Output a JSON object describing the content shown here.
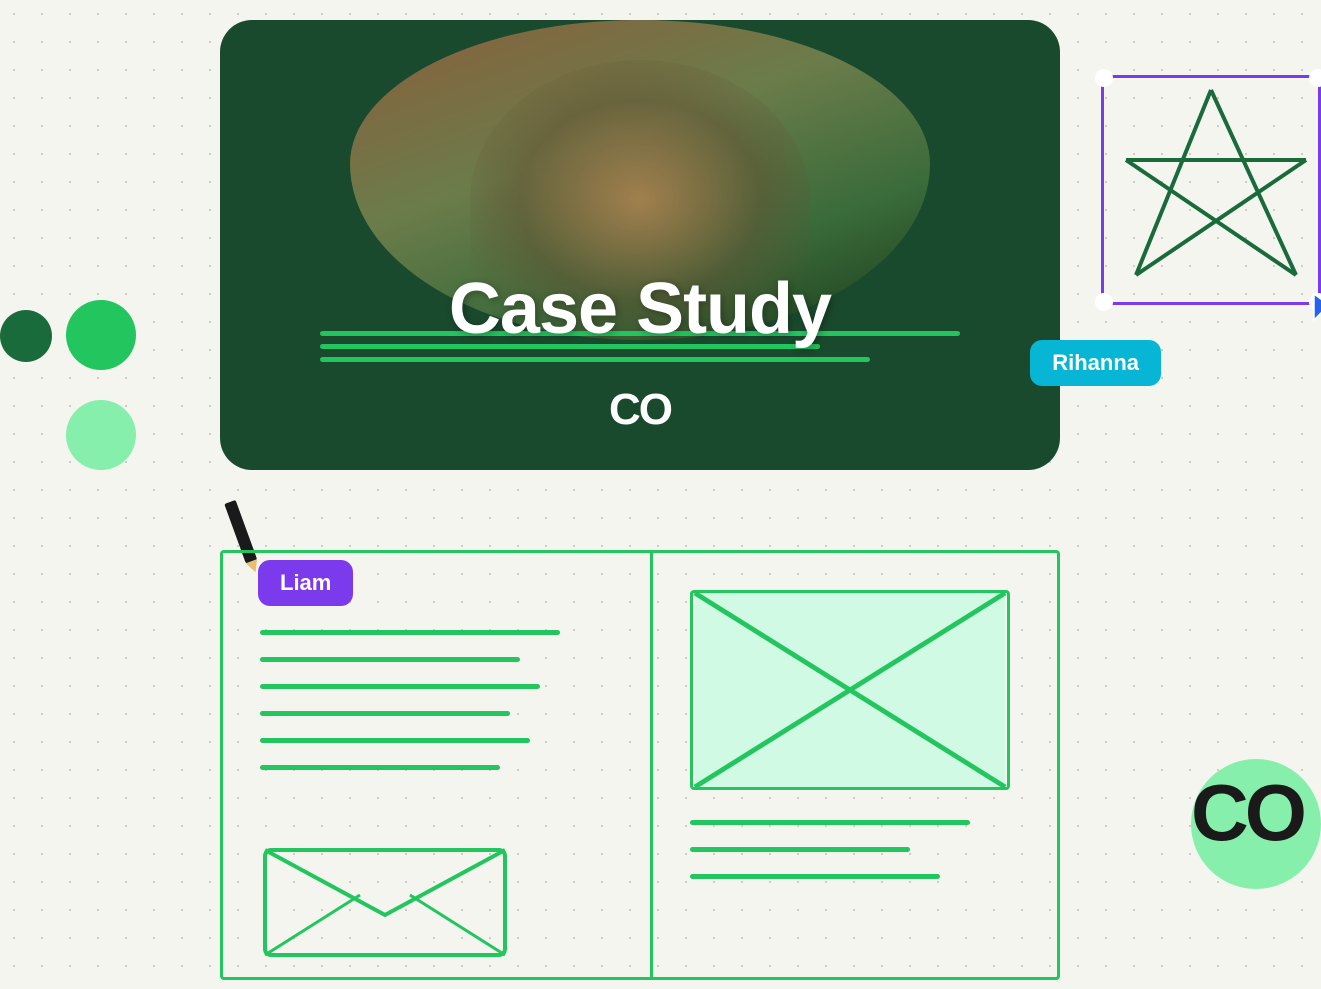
{
  "decorative": {
    "circles": {
      "dark_green": "decorative circle dark green",
      "medium_green": "decorative circle medium green",
      "light_green": "decorative circle light green"
    }
  },
  "top_card": {
    "title": "Case Study",
    "co_logo": "CO",
    "rihanna_badge": "Rihanna"
  },
  "bottom_area": {
    "liam_badge": "Liam",
    "co_logo_br": "CO"
  }
}
